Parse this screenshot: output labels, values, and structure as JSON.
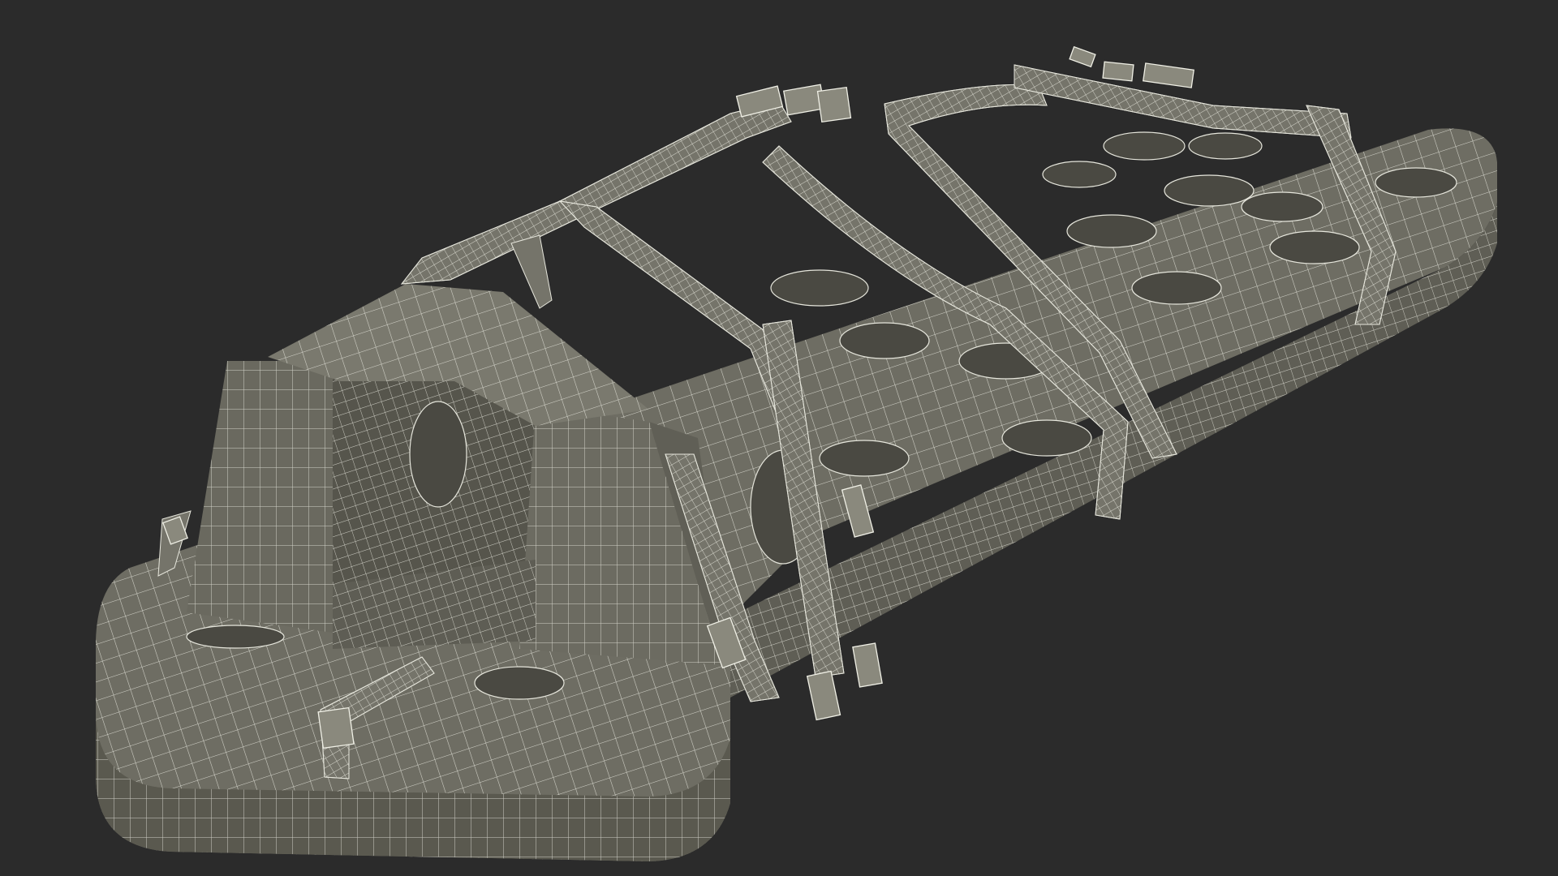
{
  "scene": {
    "subject": "spine-board-stretcher-wireframe",
    "background_color": "#2b2b2b",
    "surface_color": "#6e6d63",
    "surface_dark_color": "#56554c",
    "surface_light_color": "#7c7b70",
    "wire_color": "#e6e6dc",
    "strap_color": "#75746a",
    "hole_color": "#4a4942"
  }
}
